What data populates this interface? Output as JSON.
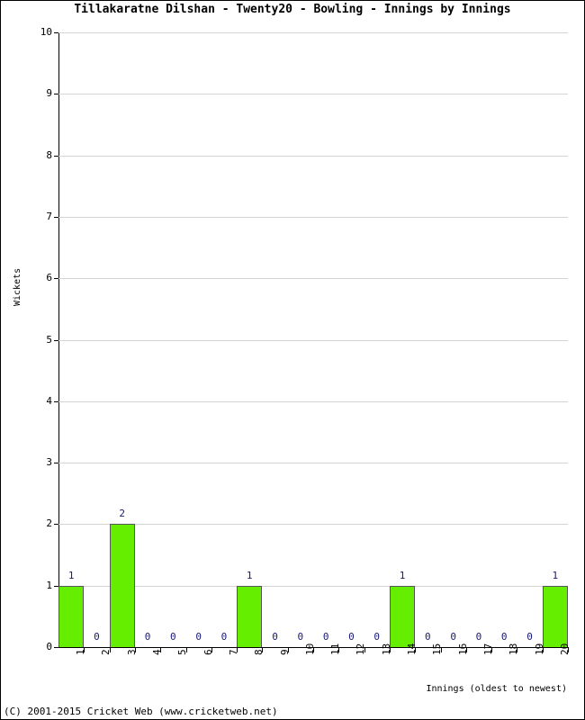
{
  "chart_data": {
    "type": "bar",
    "title": "Tillakaratne Dilshan - Twenty20 - Bowling - Innings by Innings",
    "xlabel": "Innings (oldest to newest)",
    "ylabel": "Wickets",
    "categories": [
      "1",
      "2",
      "3",
      "4",
      "5",
      "6",
      "7",
      "8",
      "9",
      "10",
      "11",
      "12",
      "13",
      "14",
      "15",
      "16",
      "17",
      "18",
      "19",
      "20"
    ],
    "values": [
      1,
      0,
      2,
      0,
      0,
      0,
      0,
      1,
      0,
      0,
      0,
      0,
      0,
      1,
      0,
      0,
      0,
      0,
      0,
      1
    ],
    "data_labels": [
      "1",
      "0",
      "2",
      "0",
      "0",
      "0",
      "0",
      "1",
      "0",
      "0",
      "0",
      "0",
      "0",
      "1",
      "0",
      "0",
      "0",
      "0",
      "0",
      "1"
    ],
    "ylim": [
      0,
      10
    ],
    "y_ticks": [
      "0",
      "1",
      "2",
      "3",
      "4",
      "5",
      "6",
      "7",
      "8",
      "9",
      "10"
    ],
    "grid": true,
    "legend": "none",
    "bar_color": "#66ee00",
    "label_color": "#19197a",
    "grid_color": "#d4d4d4",
    "axis_color": "#000000"
  },
  "footer": {
    "copyright": "(C) 2001-2015 Cricket Web (www.cricketweb.net)"
  }
}
